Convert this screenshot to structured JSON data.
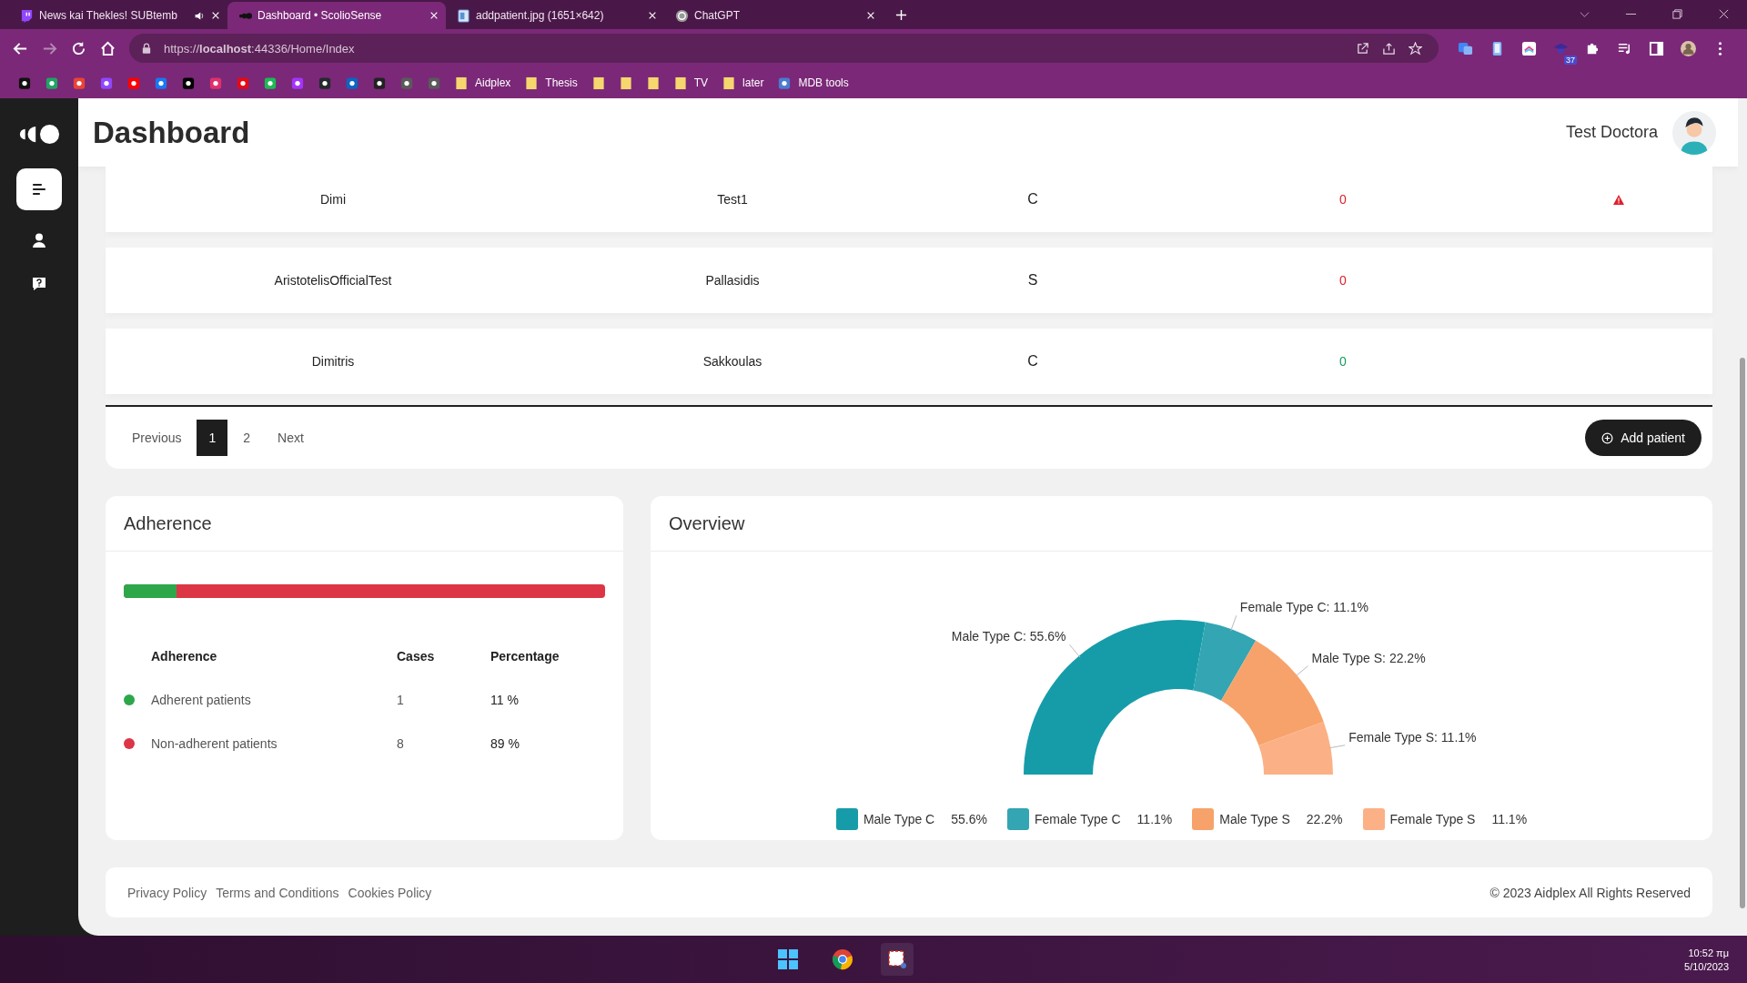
{
  "browser": {
    "tabs": [
      {
        "title": "News kai Thekles! SUBtemb",
        "kind": "twitch",
        "audio": true,
        "selected": false
      },
      {
        "title": "Dashboard • ScolioSense",
        "kind": "app",
        "audio": false,
        "selected": true
      },
      {
        "title": "addpatient.jpg (1651×642)",
        "kind": "image",
        "audio": false,
        "selected": false
      },
      {
        "title": "ChatGPT",
        "kind": "chatgpt",
        "audio": false,
        "selected": false
      }
    ],
    "url": "https://**localhost**:44336/Home/Index",
    "extension_badge": "37",
    "bookmarks": [
      {
        "kind": "site",
        "color": "#111111"
      },
      {
        "kind": "site",
        "color": "#1fa463"
      },
      {
        "kind": "site",
        "color": "#ea4335"
      },
      {
        "kind": "site",
        "color": "#9146ff"
      },
      {
        "kind": "site",
        "color": "#ff0000"
      },
      {
        "kind": "site",
        "color": "#1877f2"
      },
      {
        "kind": "site",
        "color": "#000000"
      },
      {
        "kind": "site",
        "color": "#e1306c"
      },
      {
        "kind": "site",
        "color": "#e50914"
      },
      {
        "kind": "site",
        "color": "#1db954"
      },
      {
        "kind": "site",
        "color": "#a334fa"
      },
      {
        "kind": "site",
        "color": "#24292e"
      },
      {
        "kind": "site",
        "color": "#0a66c2"
      },
      {
        "kind": "site",
        "color": "#222222"
      },
      {
        "kind": "site",
        "color": "#5a5a5a"
      },
      {
        "kind": "site",
        "color": "#5a5a5a"
      },
      {
        "kind": "folder",
        "label": "Aidplex"
      },
      {
        "kind": "folder",
        "label": "Thesis"
      },
      {
        "kind": "folder"
      },
      {
        "kind": "folder"
      },
      {
        "kind": "folder"
      },
      {
        "kind": "folder",
        "label": "TV"
      },
      {
        "kind": "folder",
        "label": "later"
      },
      {
        "kind": "site",
        "color": "#4a7bd0",
        "label": "MDB tools"
      }
    ]
  },
  "app": {
    "header": {
      "title": "Dashboard",
      "user": "Test Doctora"
    },
    "sidebar": {
      "items": [
        {
          "kind": "dashboard",
          "selected": true
        },
        {
          "kind": "patients",
          "selected": false
        },
        {
          "kind": "help",
          "selected": false
        }
      ]
    },
    "patients": {
      "rows": [
        {
          "first_name": "Dimi",
          "last_name": "Test1",
          "type": "C",
          "count": "0",
          "color": "#e0202c",
          "alert": true
        },
        {
          "first_name": "AristotelisOfficialTest",
          "last_name": "Pallasidis",
          "type": "S",
          "count": "0",
          "color": "#e0202c",
          "alert": false
        },
        {
          "first_name": "Dimitris",
          "last_name": "Sakkoulas",
          "type": "C",
          "count": "0",
          "color": "#1a9a5a",
          "alert": false
        }
      ],
      "pagination": [
        {
          "label": "Previous",
          "selected": false
        },
        {
          "label": "1",
          "selected": true
        },
        {
          "label": "2",
          "selected": false
        },
        {
          "label": "Next",
          "selected": false
        }
      ],
      "add_button": "Add patient"
    },
    "adherence": {
      "title": "Adherence",
      "level": 0.11,
      "columns": [
        "Adherence",
        "Cases",
        "Percentage"
      ],
      "rows": [
        {
          "label": "Adherent patients",
          "cases": "1",
          "percentage": "11 %",
          "color": "#2ea64a"
        },
        {
          "label": "Non-adherent patients",
          "cases": "8",
          "percentage": "89 %",
          "color": "#dc3545"
        }
      ]
    },
    "overview": {
      "title": "Overview",
      "chart_data": {
        "type": "donut",
        "categories": [
          "Male Type C",
          "Female Type C",
          "Male Type S",
          "Female Type S"
        ],
        "values": [
          55.6,
          11.1,
          22.2,
          11.1
        ]
      },
      "slice_labels": [
        "Male Type C: 55.6%",
        "Female Type C: 11.1%",
        "Male Type S: 22.2%",
        "Female Type S: 11.1%"
      ],
      "legend": [
        {
          "value": "55.6%",
          "color": "#169ca9"
        },
        {
          "value": "11.1%",
          "color": "#33a5b3"
        },
        {
          "value": "22.2%",
          "color": "#f7a26a"
        },
        {
          "value": "11.1%",
          "color": "#fbb185"
        }
      ]
    },
    "footer": {
      "links": [
        "Privacy Policy",
        "Terms and Conditions",
        "Cookies Policy"
      ],
      "copyright": "© 2023 Aidplex All Rights Reserved"
    }
  },
  "taskbar": {
    "time": "10:52 πμ",
    "date": "5/10/2023"
  }
}
